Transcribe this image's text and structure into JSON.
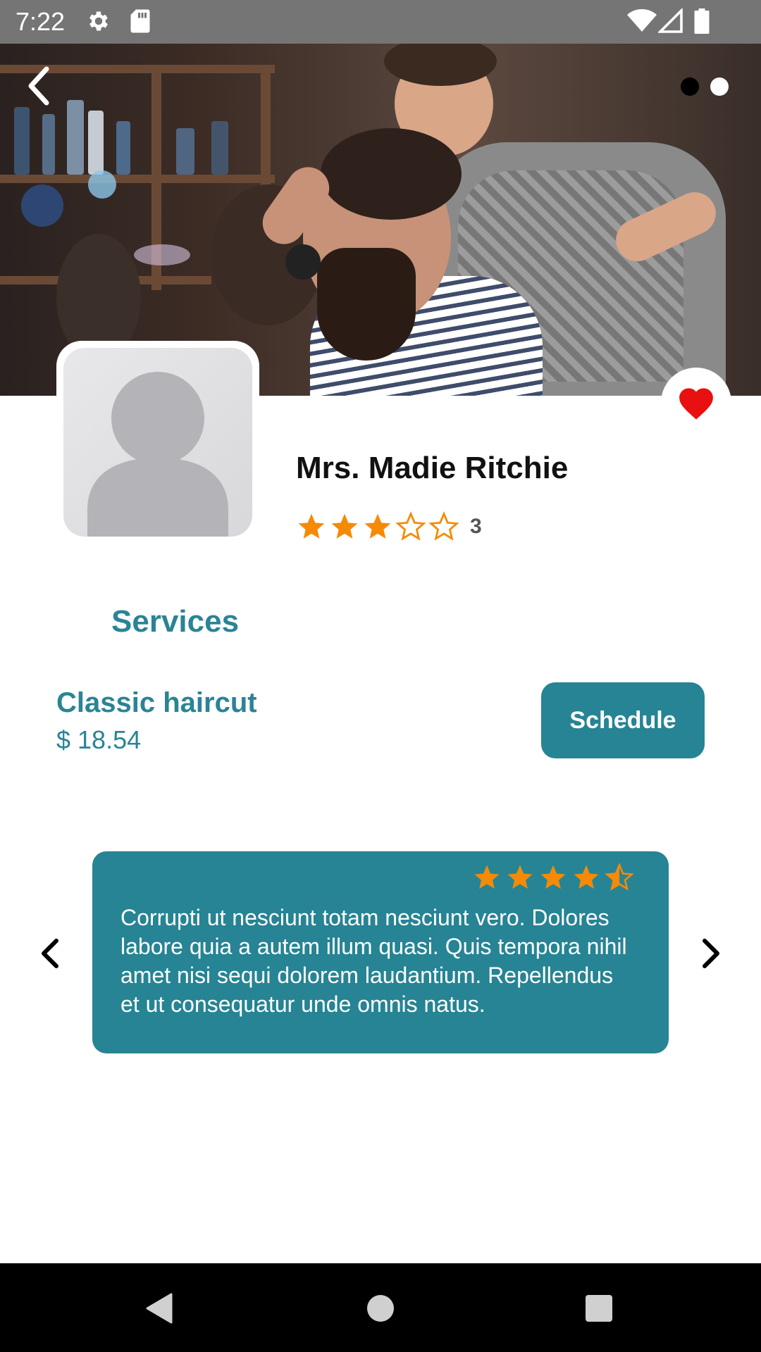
{
  "status_bar": {
    "time": "7:22",
    "icons": [
      "gear-icon",
      "sd-card-icon",
      "wifi-icon",
      "signal-icon",
      "battery-icon"
    ]
  },
  "hero": {
    "pager_dots": 2,
    "active_dot": 0
  },
  "profile": {
    "name": "Mrs. Madie Ritchie",
    "rating": 3,
    "rating_label": "3",
    "favorite": true
  },
  "services": {
    "title": "Services",
    "items": [
      {
        "name": "Classic haircut",
        "price": "$ 18.54",
        "button_label": "Schedule"
      }
    ]
  },
  "review": {
    "rating": 4.5,
    "text": "Corrupti ut nesciunt totam nesciunt vero. Dolores labore quia a autem illum quasi. Quis tempora nihil amet nisi sequi dolorem laudantium. Repellendus et ut consequatur unde omnis natus."
  },
  "colors": {
    "accent": "#268494",
    "star": "#f58a07",
    "heart": "#e81010",
    "status_bar": "#757575"
  }
}
